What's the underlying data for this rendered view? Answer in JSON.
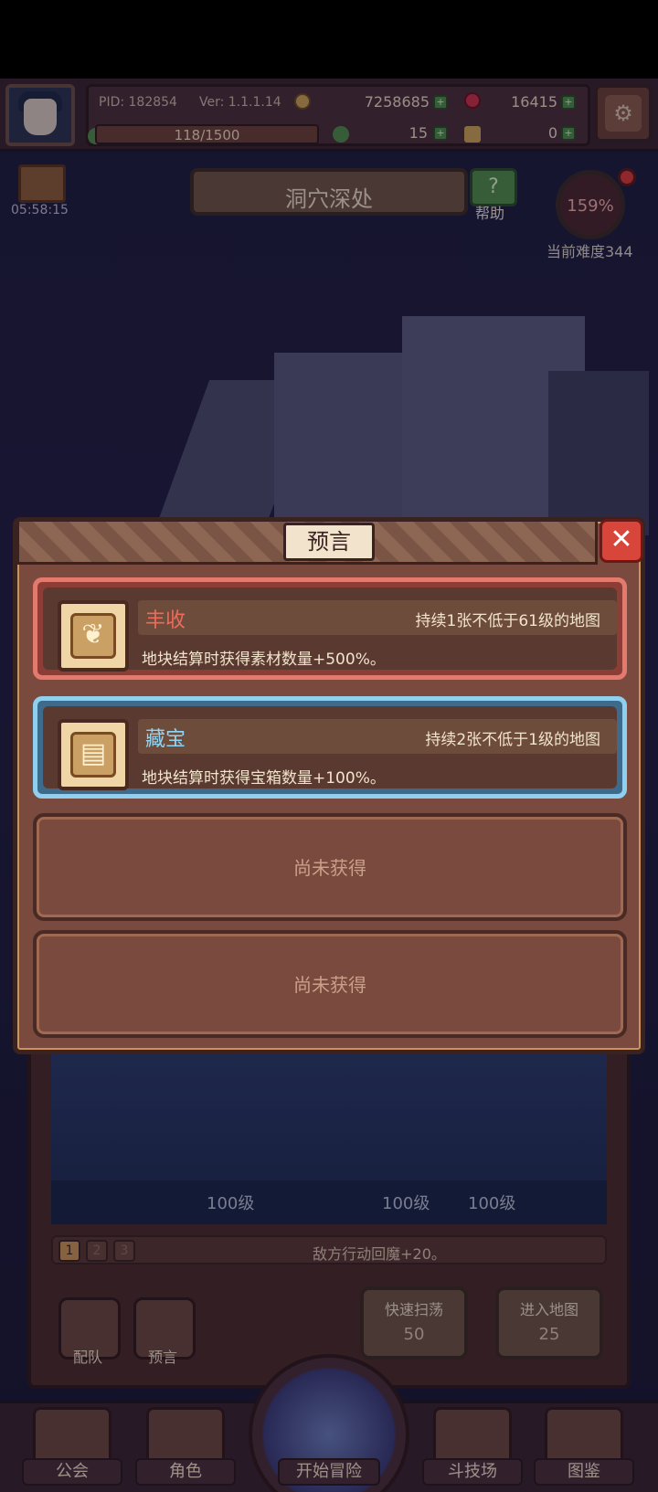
{
  "hud": {
    "pid": "PID: 182854",
    "version": "Ver: 1.1.1.14",
    "gold": "7258685",
    "gems": "16415",
    "exp": "118/1500",
    "clover": "15",
    "keys": "0"
  },
  "header": {
    "timer": "05:58:15",
    "stage_title": "洞穴深处",
    "help_label": "帮助",
    "difficulty_percent": "159%",
    "difficulty_label": "当前难度344"
  },
  "modal": {
    "title": "预言",
    "close_symbol": "✕",
    "cards": [
      {
        "name": "丰收",
        "duration": "持续1张不低于61级的地图",
        "description": "地块结算时获得素材数量+500%。",
        "icon": "wheat-icon",
        "glyph": "❦"
      },
      {
        "name": "藏宝",
        "duration": "持续2张不低于1级的地图",
        "description": "地块结算时获得宝箱数量+100%。",
        "icon": "scroll-icon",
        "glyph": "▤"
      }
    ],
    "empty_slots": [
      "尚未获得",
      "尚未获得"
    ]
  },
  "team": {
    "levels": [
      "100级",
      "100级",
      "100级"
    ],
    "pages": [
      "1",
      "2",
      "3"
    ],
    "effect_text": "敌方行动回魔+20。",
    "formation_label": "配队",
    "prophecy_label": "预言",
    "sweep_label": "快速扫荡",
    "sweep_cost": "50",
    "enter_label": "进入地图",
    "enter_cost": "25"
  },
  "nav": {
    "guild": "公会",
    "character": "角色",
    "start": "开始冒险",
    "arena": "斗技场",
    "codex": "图鉴"
  },
  "colors": {
    "accent_red": "#f06a5a",
    "accent_blue": "#8fd6f6",
    "panel": "#7a4a3e"
  }
}
